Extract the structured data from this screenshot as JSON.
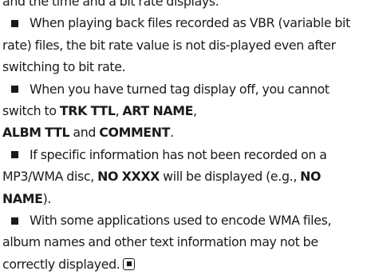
{
  "top_fragment": "and the time and a bit rate displays.",
  "notes": [
    {
      "segments": [
        {
          "t": "When playing back files recorded as VBR (variable bit rate) files, the bit rate value is not dis-played even after switching to bit rate.",
          "b": false
        }
      ]
    },
    {
      "segments": [
        {
          "t": "When you have turned tag display off, you cannot switch to ",
          "b": false
        },
        {
          "t": "TRK TTL",
          "b": true
        },
        {
          "t": ", ",
          "b": false
        },
        {
          "t": "ART NAME",
          "b": true
        },
        {
          "t": ", ",
          "b": false
        },
        {
          "t": "ALBM TTL",
          "b": true
        },
        {
          "t": " and ",
          "b": false
        },
        {
          "t": "COMMENT",
          "b": true
        },
        {
          "t": ".",
          "b": false
        }
      ]
    },
    {
      "segments": [
        {
          "t": "If specific information has not been recorded on a MP3/WMA disc, ",
          "b": false
        },
        {
          "t": "NO XXXX",
          "b": true
        },
        {
          "t": " will be displayed (e.g., ",
          "b": false
        },
        {
          "t": "NO NAME",
          "b": true
        },
        {
          "t": ").",
          "b": false
        }
      ]
    },
    {
      "segments": [
        {
          "t": "With some applications used to encode WMA files, album names and other text information may not be correctly displayed.",
          "b": false
        }
      ]
    }
  ],
  "end_icon": "end-of-section-icon"
}
